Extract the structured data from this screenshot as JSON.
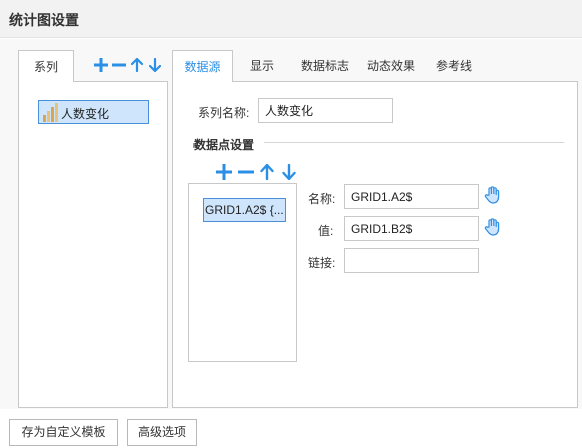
{
  "dialog": {
    "title": "统计图设置"
  },
  "series_panel": {
    "tab_label": "系列",
    "toolbar_icons": [
      "plus-icon",
      "minus-icon",
      "arrow-up-icon",
      "arrow-down-icon"
    ],
    "items": [
      {
        "label": "人数变化",
        "selected": true
      }
    ]
  },
  "tabs": [
    {
      "label": "数据源",
      "active": true
    },
    {
      "label": "显示",
      "active": false
    },
    {
      "label": "数据标志",
      "active": false
    },
    {
      "label": "动态效果",
      "active": false
    },
    {
      "label": "参考线",
      "active": false
    }
  ],
  "datasource": {
    "series_name_label": "系列名称:",
    "series_name_value": "人数变化",
    "points_section_title": "数据点设置",
    "points": [
      {
        "label": "GRID1.A2$ {..."
      }
    ],
    "name_label": "名称:",
    "name_value": "GRID1.A2$",
    "value_label": "值:",
    "value_value": "GRID1.B2$",
    "link_label": "链接:",
    "link_value": ""
  },
  "footer": {
    "save_template_label": "存为自定义模板",
    "advanced_label": "高级选项"
  },
  "colors": {
    "accent": "#2b8fe5",
    "selection_bg": "#cfe5fb",
    "selection_border": "#4a90d9"
  }
}
